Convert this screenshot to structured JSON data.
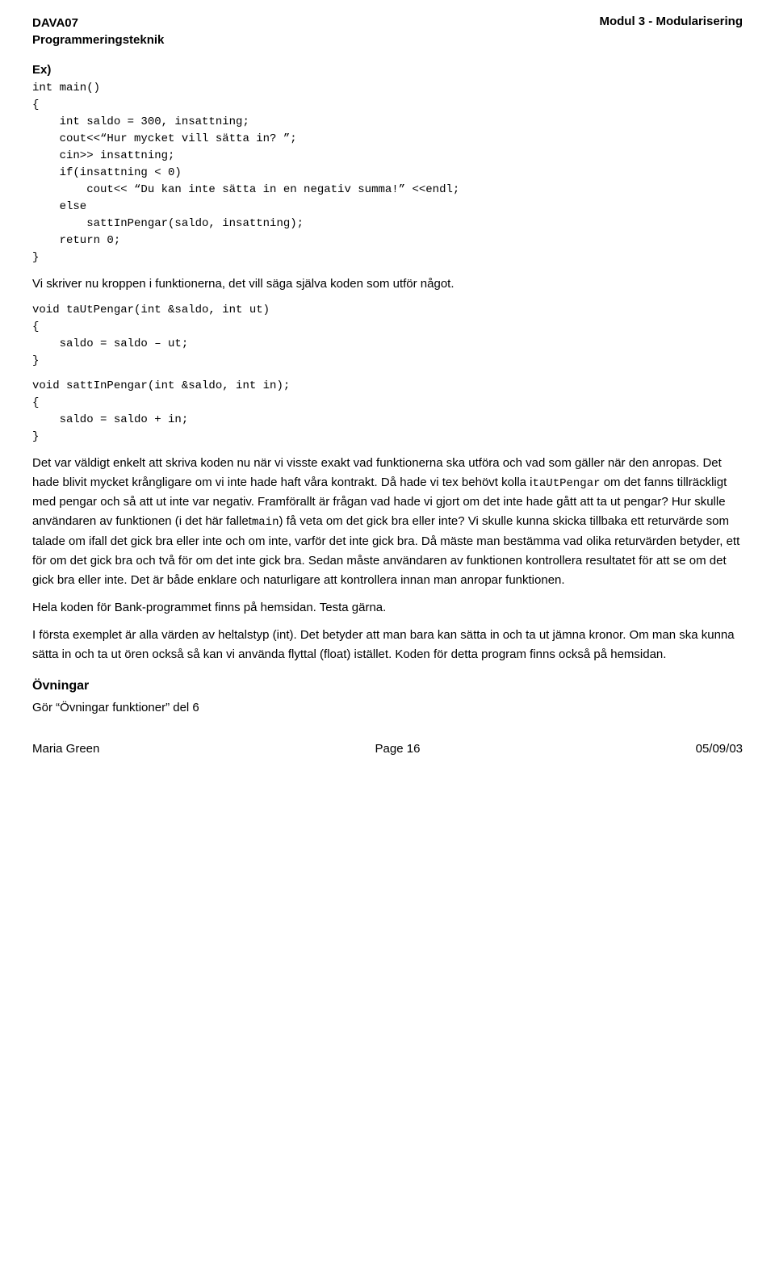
{
  "header": {
    "left_line1": "DAVA07",
    "left_line2": "Programmeringsteknik",
    "right": "Modul 3 - Modularisering"
  },
  "ex_label": "Ex)",
  "code_main": "int main()\n{\n    int saldo = 300, insattning;\n    cout<<“Hur mycket vill sätta in? ”;\n    cin>> insattning;\n    if(insattning < 0)\n        cout<< “Du kan inte sätta in en negativ summa!” <<endl;\n    else\n        sattInPengar(saldo, insattning);\n    return 0;\n}",
  "prose1": "Vi skriver nu kroppen i funktionerna, det vill säga själva koden som utför något.",
  "code_taUtPengar": "void taUtPengar(int &saldo, int ut)\n{\n    saldo = saldo – ut;\n}",
  "code_sattInPengar": "void sattInPengar(int &saldo, int in);\n{\n    saldo = saldo + in;\n}",
  "prose2": "Det var väldigt enkelt att skriva koden nu när vi visste exakt vad funktionerna ska utföra och vad som gäller när den anropas. Det hade blivit mycket krångligare om vi inte hade haft våra kontrakt. Då hade vi tex behövt kolla i",
  "prose2_code": "taUtPengar",
  "prose2b": "om det fanns tillräckligt med pengar och så att ut inte var negativ. Framförallt är frågan vad hade vi gjort om det inte hade gått att ta ut pengar? Hur skulle användaren av funktionen (i det här fallet",
  "prose2_code2": "main",
  "prose2c": ") få veta om det gick bra eller inte? Vi skulle kunna skicka tillbaka ett returvärde som talade om ifall det gick bra eller inte och om inte, varför det inte gick bra. Då mäste man bestämma vad olika returvärden betyder, ett för om det gick bra och två för om det inte gick bra. Sedan måste användaren av funktionen kontrollera resultatet för att se om det gick bra eller inte. Det är både enklare och naturligare att kontrollera innan man anropar funktionen.",
  "prose3": "Hela koden för Bank-programmet finns på hemsidan. Testa gärna.",
  "prose4_a": "I första exemplet är alla värden av heltalstyp (int). Det betyder att man bara kan sätta in och ta ut jämna kronor. Om man ska kunna sätta in och ta ut ören också så kan vi använda flyttal (float) istället. Koden för detta program finns också på hemsidan.",
  "section_ovningar": "Övningar",
  "ovningar_text": "Gör “Övningar funktioner” del 6",
  "footer": {
    "left": "Maria Green",
    "center": "Page 16",
    "right": "05/09/03"
  }
}
